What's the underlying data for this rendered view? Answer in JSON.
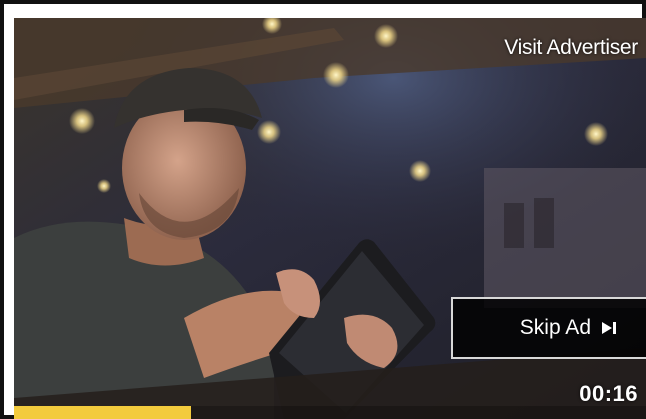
{
  "ad": {
    "visit_label": "Visit Advertiser",
    "skip_label": "Skip Ad",
    "skip_icon": "skip-next-icon",
    "time_remaining": "00:16",
    "progress_fraction": 0.28
  },
  "colors": {
    "progress": "#f3cb3d",
    "overlay": "#000000",
    "text": "#ffffff"
  }
}
